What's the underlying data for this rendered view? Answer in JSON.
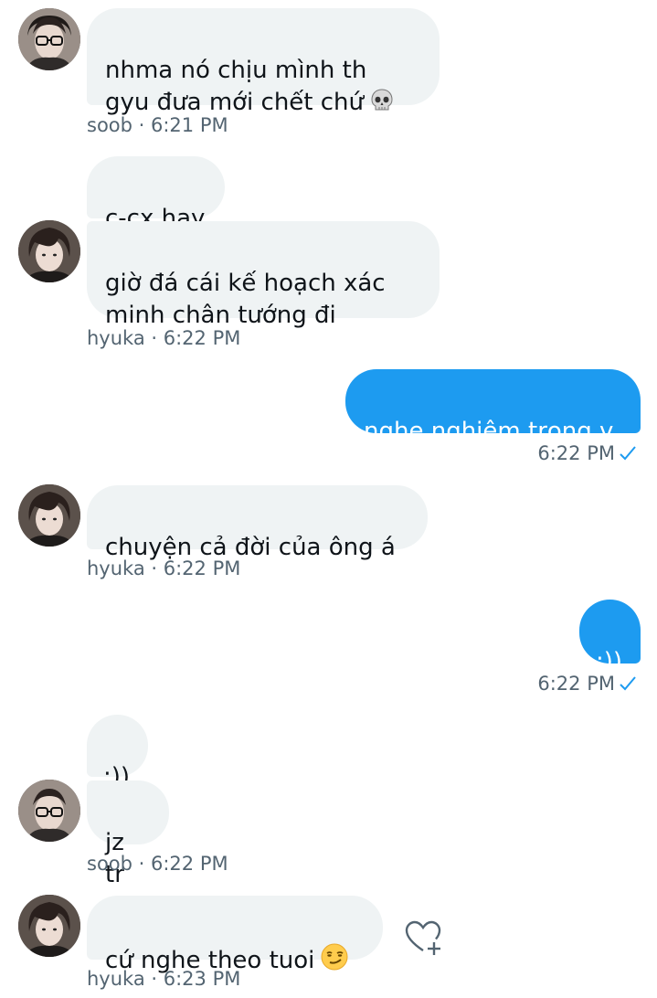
{
  "conversation": [
    {
      "sender": "soob",
      "direction": "incoming",
      "bubbles": [
        {
          "text": "nhma nó chịu mình th\ngyu đưa mới chết chứ",
          "emoji": "skull"
        }
      ],
      "meta": "soob · 6:21 PM"
    },
    {
      "sender": "hyuka",
      "direction": "incoming",
      "bubbles": [
        {
          "text": "c-cx hay"
        },
        {
          "text": "giờ đá cái kế hoạch xác\nminh chân tướng đi"
        }
      ],
      "meta": "hyuka · 6:22 PM"
    },
    {
      "sender": "me",
      "direction": "outgoing",
      "bubbles": [
        {
          "text": "nghe nghiêm trọng v"
        }
      ],
      "meta": "6:22 PM"
    },
    {
      "sender": "hyuka",
      "direction": "incoming",
      "bubbles": [
        {
          "text": "chuyện cả đời của ông á"
        }
      ],
      "meta": "hyuka · 6:22 PM"
    },
    {
      "sender": "me",
      "direction": "outgoing",
      "bubbles": [
        {
          "text": ":))"
        }
      ],
      "meta": "6:22 PM"
    },
    {
      "sender": "soob",
      "direction": "incoming",
      "bubbles": [
        {
          "text": ":))"
        },
        {
          "text": "jz tr"
        }
      ],
      "meta": "soob · 6:22 PM"
    },
    {
      "sender": "hyuka",
      "direction": "incoming",
      "bubbles": [
        {
          "text": "cứ nghe theo tuoi",
          "emoji": "smirk"
        }
      ],
      "meta": "hyuka · 6:23 PM"
    }
  ],
  "icons": {
    "read_receipt": "check-icon",
    "add_reaction": "heart-plus-icon",
    "skull_emoji": "skull-icon",
    "smirk_emoji": "smirk-icon"
  },
  "colors": {
    "outgoing_bubble": "#1d9bf0",
    "incoming_bubble": "#eff3f4",
    "meta_text": "#536471",
    "check": "#1d9bf0"
  }
}
